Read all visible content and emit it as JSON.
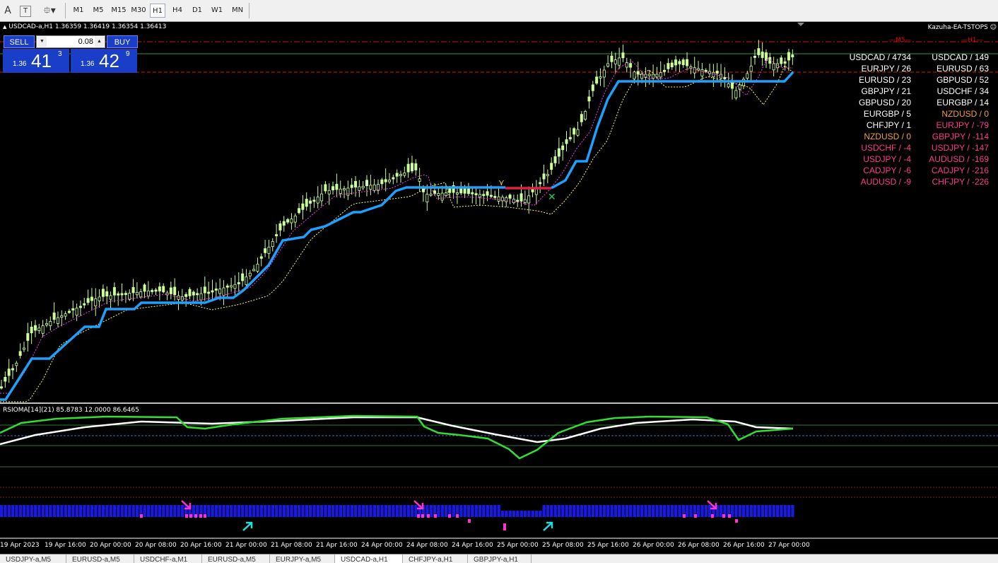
{
  "toolbar": {
    "icons": [
      "text-cursor-icon",
      "text-label-icon",
      "objects-icon"
    ],
    "timeframes": [
      "M1",
      "M5",
      "M15",
      "M30",
      "H1",
      "H4",
      "D1",
      "W1",
      "MN"
    ],
    "active_timeframe": "H1"
  },
  "chart": {
    "ohlc_header": "USDCAD-a,H1  1.36359 1.36419 1.36354 1.36413",
    "ea_name": "Kazuha-EA-TSTOPS",
    "level_m5": "M5",
    "level_h1": "H1"
  },
  "trade_panel": {
    "sell_label": "SELL",
    "buy_label": "BUY",
    "lot": "0.08",
    "sell_prefix": "1.36",
    "sell_big": "41",
    "sell_sup": "3",
    "buy_prefix": "1.36",
    "buy_big": "42",
    "buy_sup": "9"
  },
  "correlation": {
    "left": [
      {
        "text": "USDCAD / 4734",
        "color": "#ffffff"
      },
      {
        "text": "EURJPY / 26",
        "color": "#ffffff"
      },
      {
        "text": "EURUSD / 23",
        "color": "#ffffff"
      },
      {
        "text": "GBPJPY / 21",
        "color": "#ffffff"
      },
      {
        "text": "GBPUSD / 20",
        "color": "#ffffff"
      },
      {
        "text": "EURGBP / 5",
        "color": "#ffffff"
      },
      {
        "text": "CHFJPY / 1",
        "color": "#ffffff"
      },
      {
        "text": "NZDUSD / 0",
        "color": "#f0a030"
      },
      {
        "text": "USDCHF / -4",
        "color": "#ff3a8c"
      },
      {
        "text": "USDJPY / -4",
        "color": "#ff3a8c"
      },
      {
        "text": "CADJPY / -6",
        "color": "#ff3a8c"
      },
      {
        "text": "AUDUSD / -9",
        "color": "#ff3a8c"
      }
    ],
    "right": [
      {
        "text": "USDCAD / 149",
        "color": "#ffffff"
      },
      {
        "text": "EURUSD / 63",
        "color": "#ffffff"
      },
      {
        "text": "GBPUSD / 52",
        "color": "#ffffff"
      },
      {
        "text": "USDCHF / 34",
        "color": "#ffffff"
      },
      {
        "text": "EURGBP / 14",
        "color": "#ffffff"
      },
      {
        "text": "NZDUSD / 0",
        "color": "#f0a030"
      },
      {
        "text": "EURJPY / -79",
        "color": "#ff3a8c"
      },
      {
        "text": "GBPJPY / -114",
        "color": "#ff3a8c"
      },
      {
        "text": "USDJPY / -147",
        "color": "#ff3a8c"
      },
      {
        "text": "AUDUSD / -169",
        "color": "#ff3a8c"
      },
      {
        "text": "CADJPY / -216",
        "color": "#ff3a8c"
      },
      {
        "text": "CHFJPY / -226",
        "color": "#ff3a8c"
      }
    ]
  },
  "indicator": {
    "label": "RSIOMA[14](21) 85.8783 12.0000 86.6465"
  },
  "x_axis": [
    "19 Apr 2023",
    "19 Apr 16:00",
    "20 Apr 00:00",
    "20 Apr 08:00",
    "20 Apr 16:00",
    "21 Apr 00:00",
    "21 Apr 08:00",
    "21 Apr 16:00",
    "24 Apr 00:00",
    "24 Apr 08:00",
    "24 Apr 16:00",
    "25 Apr 00:00",
    "25 Apr 08:00",
    "25 Apr 16:00",
    "26 Apr 00:00",
    "26 Apr 08:00",
    "26 Apr 16:00",
    "27 Apr 00:00"
  ],
  "tabs": [
    "USDJPY-a,M5",
    "EURUSD-a,M5",
    "USDCHF-a,M1",
    "EURUSD-a,M5",
    "EURJPY-a,M5",
    "USDCAD-a,H1",
    "CHFJPY-a,H1",
    "GBPJPY-a,H1"
  ],
  "active_tab": "USDCAD-a,H1",
  "colors": {
    "candle": "#ccff99",
    "trail_stop": "#1ea0ff",
    "trail_stop_flat": "#e02040",
    "ma_fast": "#ff33ff",
    "ma_slow": "#ffff66",
    "rsi": "#33dd33",
    "rsi_signal": "#ffffff",
    "histogram": "#1a1adf",
    "hist_signal": "#ff33cc",
    "arrow_down": "#ff33cc",
    "arrow_up": "#22dddd"
  }
}
